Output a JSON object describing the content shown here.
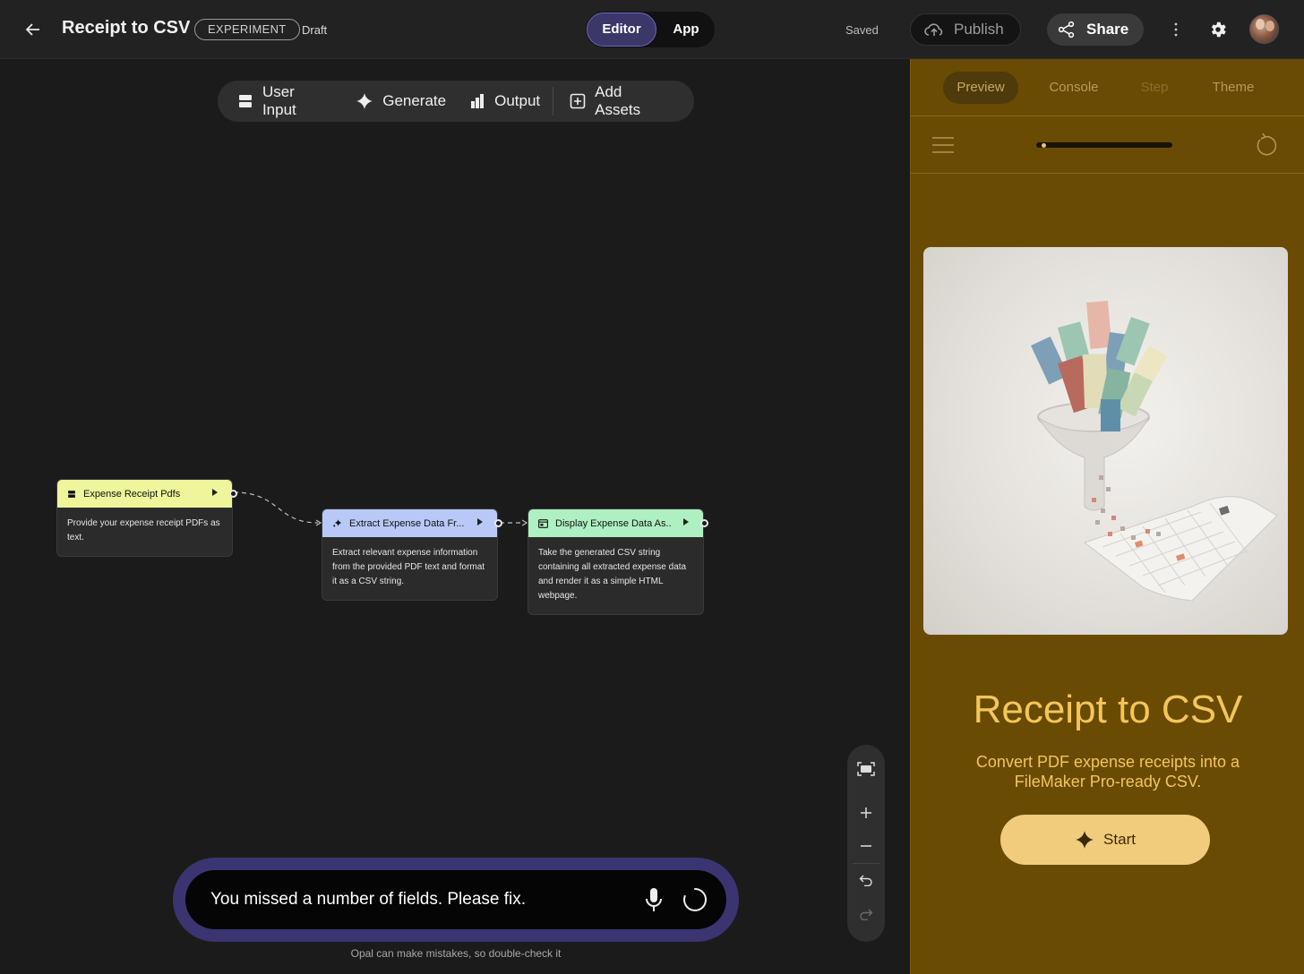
{
  "header": {
    "title": "Receipt to CSV",
    "badge": "EXPERIMENT",
    "status": "Draft",
    "mode_editor": "Editor",
    "mode_app": "App",
    "save_status": "Saved",
    "publish_label": "Publish",
    "share_label": "Share"
  },
  "toolbar": {
    "user_input": "User Input",
    "generate": "Generate",
    "output": "Output",
    "add_assets": "Add Assets"
  },
  "nodes": [
    {
      "title": "Expense Receipt Pdfs",
      "body": "Provide your expense receipt PDFs as text.",
      "color": "#eef59a"
    },
    {
      "title": "Extract Expense Data Fr...",
      "body": "Extract relevant expense information from the provided PDF text and format it as a CSV string.",
      "color": "#b9c9f7"
    },
    {
      "title": "Display Expense Data As...",
      "body": "Take the generated CSV string containing all extracted expense data and render it as a simple HTML webpage.",
      "color": "#aef0c2"
    }
  ],
  "chat": {
    "value": "You missed a number of fields. Please fix.",
    "disclaimer": "Opal can make mistakes, so double-check it"
  },
  "preview": {
    "tabs": [
      "Preview",
      "Console",
      "Step",
      "Theme"
    ],
    "title": "Receipt to CSV",
    "description": "Convert PDF expense receipts into a FileMaker Pro-ready CSV.",
    "start_label": "Start",
    "progress": 0.02
  },
  "colors": {
    "accent": "#3b3768",
    "theme_bg": "#6a4b04",
    "theme_text": "#f3c65a",
    "start_button": "#f1cc7c"
  }
}
